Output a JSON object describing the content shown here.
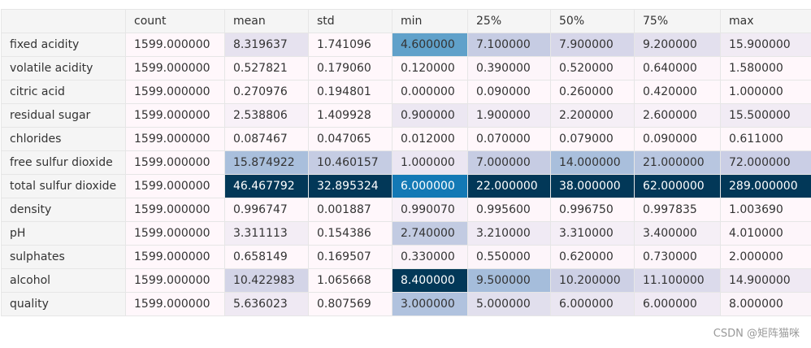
{
  "table": {
    "columns": [
      "count",
      "mean",
      "std",
      "min",
      "25%",
      "50%",
      "75%",
      "max"
    ],
    "rows": [
      {
        "label": "fixed acidity",
        "values": [
          "1599.000000",
          "8.319637",
          "1.741096",
          "4.600000",
          "7.100000",
          "7.900000",
          "9.200000",
          "15.900000"
        ],
        "colors": [
          "#fff7fb",
          "#e6e2ef",
          "#fff7fb",
          "#60a1ca",
          "#c6cce3",
          "#d6d6e9",
          "#e3e0ee",
          "#f1ebf4"
        ]
      },
      {
        "label": "volatile acidity",
        "values": [
          "1599.000000",
          "0.527821",
          "0.179060",
          "0.120000",
          "0.390000",
          "0.520000",
          "0.640000",
          "1.580000"
        ],
        "colors": [
          "#fff7fb",
          "#fff7fb",
          "#fff7fb",
          "#fff7fb",
          "#fdf5fa",
          "#fdf5fa",
          "#fdf5fa",
          "#fff7fb"
        ]
      },
      {
        "label": "citric acid",
        "values": [
          "1599.000000",
          "0.270976",
          "0.194801",
          "0.000000",
          "0.090000",
          "0.260000",
          "0.420000",
          "1.000000"
        ],
        "colors": [
          "#fff7fb",
          "#fff7fb",
          "#fff7fb",
          "#fff7fb",
          "#fff7fb",
          "#fff7fb",
          "#fff7fb",
          "#fff7fb"
        ]
      },
      {
        "label": "residual sugar",
        "values": [
          "1599.000000",
          "2.538806",
          "1.409928",
          "0.900000",
          "1.900000",
          "2.200000",
          "2.600000",
          "15.500000"
        ],
        "colors": [
          "#fff7fb",
          "#f8f1f8",
          "#fff7fb",
          "#ece7f2",
          "#f2ecf5",
          "#f5eff6",
          "#f8f1f8",
          "#f1ebf4"
        ]
      },
      {
        "label": "chlorides",
        "values": [
          "1599.000000",
          "0.087467",
          "0.047065",
          "0.012000",
          "0.070000",
          "0.079000",
          "0.090000",
          "0.611000"
        ],
        "colors": [
          "#fff7fb",
          "#fff7fb",
          "#fff7fb",
          "#fff7fb",
          "#fff7fb",
          "#fff7fb",
          "#fff7fb",
          "#fff7fb"
        ]
      },
      {
        "label": "free sulfur dioxide",
        "values": [
          "1599.000000",
          "15.874922",
          "10.460157",
          "1.000000",
          "7.000000",
          "14.000000",
          "21.000000",
          "72.000000"
        ],
        "colors": [
          "#fff7fb",
          "#a9bfdc",
          "#c5cce3",
          "#ebe6f2",
          "#c6cce3",
          "#a9bfdc",
          "#b8c6e0",
          "#cacee5"
        ]
      },
      {
        "label": "total sulfur dioxide",
        "values": [
          "1599.000000",
          "46.467792",
          "32.895324",
          "6.000000",
          "22.000000",
          "38.000000",
          "62.000000",
          "289.000000"
        ],
        "colors": [
          "#fff7fb",
          "#023858",
          "#023858",
          "#1379b5",
          "#023858",
          "#023858",
          "#023858",
          "#023858"
        ]
      },
      {
        "label": "density",
        "values": [
          "1599.000000",
          "0.996747",
          "0.001887",
          "0.990070",
          "0.995600",
          "0.996750",
          "0.997835",
          "1.003690"
        ],
        "colors": [
          "#fff7fb",
          "#fff7fb",
          "#fff7fb",
          "#f8f1f8",
          "#fef6fa",
          "#fff7fb",
          "#fff7fb",
          "#fff7fb"
        ]
      },
      {
        "label": "pH",
        "values": [
          "1599.000000",
          "3.311113",
          "0.154386",
          "2.740000",
          "3.210000",
          "3.310000",
          "3.400000",
          "4.010000"
        ],
        "colors": [
          "#fff7fb",
          "#f3edf5",
          "#fff7fb",
          "#c2cbe2",
          "#f0eaf4",
          "#f4eef6",
          "#f5eff6",
          "#fdf5fa"
        ]
      },
      {
        "label": "sulphates",
        "values": [
          "1599.000000",
          "0.658149",
          "0.169507",
          "0.330000",
          "0.550000",
          "0.620000",
          "0.730000",
          "2.000000"
        ],
        "colors": [
          "#fff7fb",
          "#fff7fb",
          "#fff7fb",
          "#fbf3f9",
          "#fdf5fa",
          "#fdf5fa",
          "#fdf5fa",
          "#fff7fb"
        ]
      },
      {
        "label": "alcohol",
        "values": [
          "1599.000000",
          "10.422983",
          "1.065668",
          "8.400000",
          "9.500000",
          "10.200000",
          "11.100000",
          "14.900000"
        ],
        "colors": [
          "#fff7fb",
          "#d3d4e7",
          "#fff7fb",
          "#023858",
          "#a5bddb",
          "#cdd0e5",
          "#dbdaeb",
          "#efe9f3"
        ]
      },
      {
        "label": "quality",
        "values": [
          "1599.000000",
          "5.636023",
          "0.807569",
          "3.000000",
          "5.000000",
          "6.000000",
          "6.000000",
          "8.000000"
        ],
        "colors": [
          "#fff7fb",
          "#efe9f3",
          "#fff7fb",
          "#b0c2de",
          "#e1dfed",
          "#eae6f1",
          "#f0eaf4",
          "#fbf4f9"
        ]
      }
    ]
  },
  "watermark": "CSDN @矩阵猫咪"
}
